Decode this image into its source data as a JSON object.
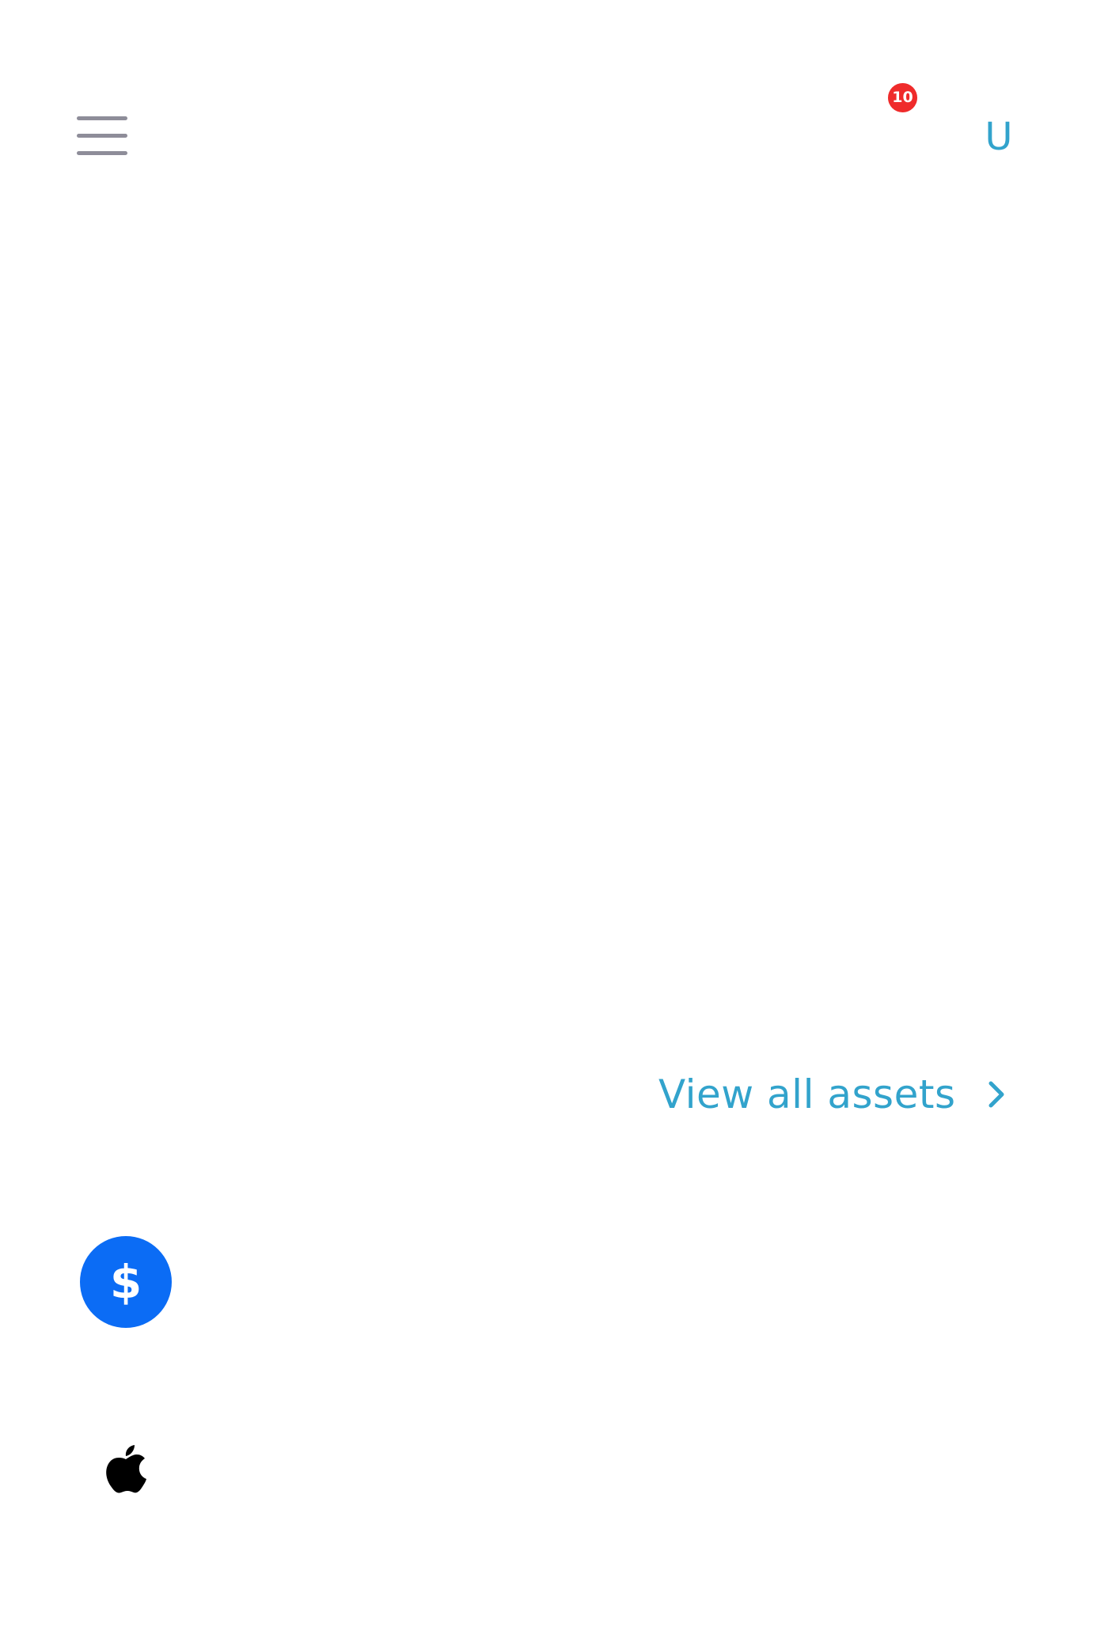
{
  "header": {
    "menu_icon": "hamburger-menu-icon",
    "notifications": {
      "icon": "bell-icon",
      "badge_count": "10",
      "badge_color": "#ef2b2b"
    },
    "avatar_initial": "U"
  },
  "assets": {
    "view_all_label": "View all assets",
    "chevron_icon": "chevron-right-icon",
    "items": [
      {
        "icon": "dollar-coin-icon",
        "symbol": "$",
        "color": "#0b6cf5"
      },
      {
        "icon": "apple-logo-icon",
        "color": "#000000"
      }
    ]
  },
  "colors": {
    "accent": "#32a3cc",
    "menu_gray": "#8e8d99",
    "background": "#ffffff"
  }
}
